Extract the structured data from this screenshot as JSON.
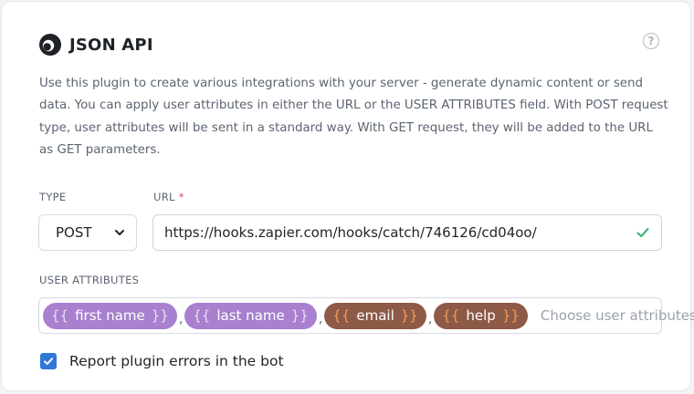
{
  "plugin": {
    "title": "JSON API",
    "help_glyph": "?",
    "description": "Use this plugin to create various integrations with your server - generate dynamic content or send data. You can apply user attributes in either the URL or the USER ATTRIBUTES field. With POST request type, user attributes will be sent in a standard way. With GET request, they will be added to the URL as GET parameters."
  },
  "type_field": {
    "label": "TYPE",
    "value": "POST"
  },
  "url_field": {
    "label": "URL",
    "required_mark": "*",
    "value": "https://hooks.zapier.com/hooks/catch/746126/cd04oo/"
  },
  "user_attributes": {
    "label": "USER ATTRIBUTES",
    "open_brace": "{{",
    "close_brace": "}}",
    "separator": ",",
    "tags": [
      {
        "text": "first name",
        "color": "#a880cf"
      },
      {
        "text": "last name",
        "color": "#a880cf"
      },
      {
        "text": "email",
        "color": "#8e5a48"
      },
      {
        "text": "help",
        "color": "#8e5a48"
      }
    ],
    "placeholder": "Choose user attributes"
  },
  "report_errors": {
    "label": "Report plugin errors in the bot",
    "checked": true
  },
  "colors": {
    "accent": "#2f78d8",
    "success": "#2fb36a",
    "required": "#e5484d"
  },
  "icons": {
    "logo": "json-api-logo-icon",
    "help": "question-circle-icon",
    "dropdown": "chevron-down-icon",
    "valid": "checkmark-icon",
    "checkbox": "checkbox-checked-icon"
  }
}
